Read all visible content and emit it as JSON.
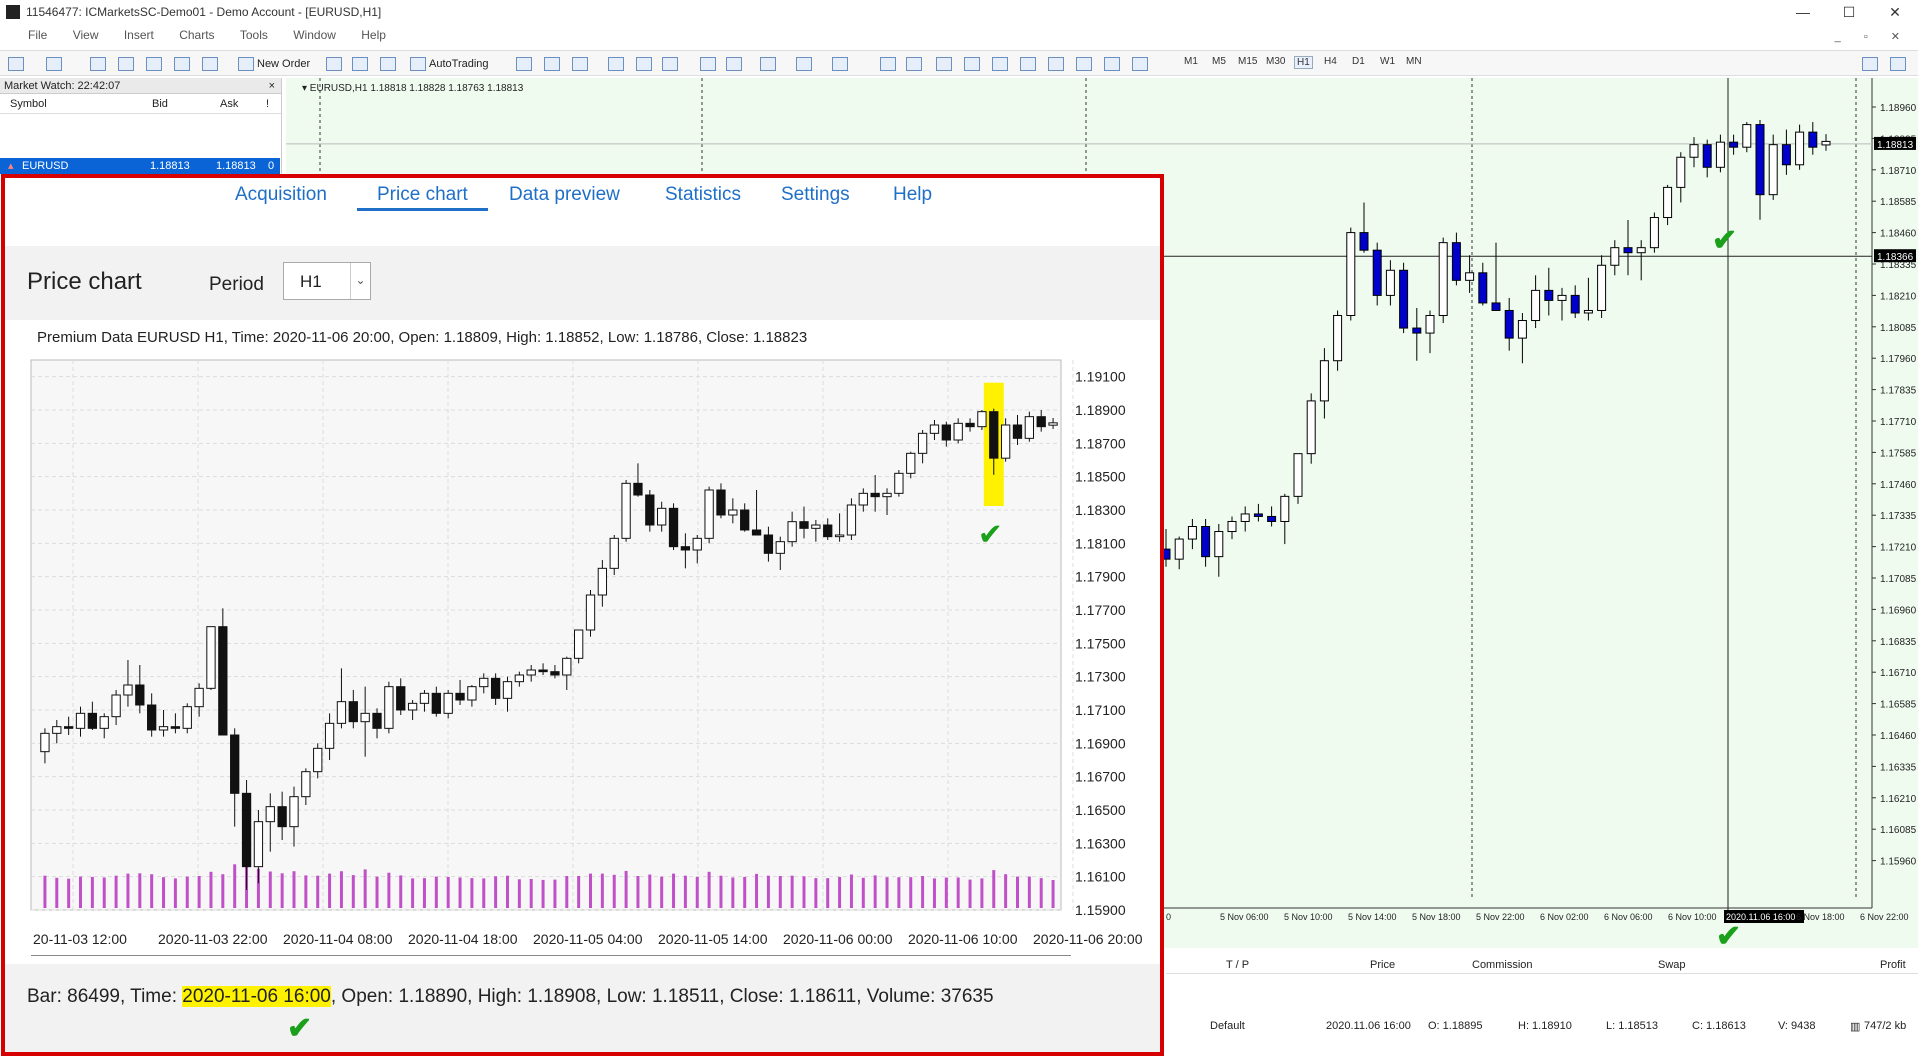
{
  "window": {
    "title": "11546477: ICMarketsSC-Demo01 - Demo Account - [EURUSD,H1]",
    "minimize": "—",
    "maximize": "☐",
    "close": "✕"
  },
  "menu": [
    "File",
    "View",
    "Insert",
    "Charts",
    "Tools",
    "Window",
    "Help"
  ],
  "mdi_controls": "_ ▫ ✕",
  "toolbar": {
    "new_order": "New Order",
    "auto_trading": "AutoTrading",
    "timeframes": [
      "M1",
      "M5",
      "M15",
      "M30",
      "H1",
      "H4",
      "D1",
      "W1",
      "MN"
    ],
    "active_timeframe": "H1"
  },
  "market_watch": {
    "title": "Market Watch: 22:42:07",
    "close": "×",
    "columns": {
      "symbol": "Symbol",
      "bid": "Bid",
      "ask": "Ask",
      "flag": "!"
    },
    "row": {
      "symbol": "EURUSD",
      "bid": "1.18813",
      "ask": "1.18813",
      "flag": "0"
    }
  },
  "mt_chart": {
    "header": "EURUSD,H1  1.18818 1.18828 1.18763 1.18813",
    "price_labels": [
      "1.18960",
      "1.18835",
      "1.18710",
      "1.18585",
      "1.18460",
      "1.18335",
      "1.18210",
      "1.18085",
      "1.17960",
      "1.17835",
      "1.17710",
      "1.17585",
      "1.17460",
      "1.17335",
      "1.17210",
      "1.17085",
      "1.16960",
      "1.16835",
      "1.16710",
      "1.16585",
      "1.16460",
      "1.16335",
      "1.16210",
      "1.16085",
      "1.15960"
    ],
    "current_price_tag": "1.18813",
    "crosshair_price_tag": "1.18366",
    "time_labels": [
      "0",
      "5 Nov 06:00",
      "5 Nov 10:00",
      "5 Nov 14:00",
      "5 Nov 18:00",
      "5 Nov 22:00",
      "6 Nov 02:00",
      "6 Nov 06:00",
      "6 Nov 10:00",
      "2020.11.06 16:00",
      "6 Nov 18:00",
      "6 Nov 22:00"
    ],
    "colors": {
      "background": "#f0fbf0",
      "bull": "#ffffff",
      "bear": "#0000cc",
      "grid": "#3a3a3a"
    }
  },
  "terminal": {
    "columns": [
      "T / P",
      "Price",
      "Commission",
      "Swap",
      "Profit"
    ]
  },
  "status_bar": {
    "profile": "Default",
    "time": "2020.11.06 16:00",
    "open": "O: 1.18895",
    "high": "H: 1.18910",
    "low": "L: 1.18513",
    "close": "C: 1.18613",
    "volume": "V: 9438",
    "traffic": "747/2 kb"
  },
  "panel": {
    "tabs": [
      {
        "label": "Acquisition",
        "active": false
      },
      {
        "label": "Price chart",
        "active": true
      },
      {
        "label": "Data preview",
        "active": false
      },
      {
        "label": "Statistics",
        "active": false
      },
      {
        "label": "Settings",
        "active": false
      },
      {
        "label": "Help",
        "active": false
      }
    ],
    "title": "Price chart",
    "period_label": "Period",
    "period_value": "H1",
    "bar_info": {
      "prefix": "Bar: 86499, Time: ",
      "time": "2020-11-06 16:00",
      "suffix": ", Open: 1.18890, High: 1.18908, Low: 1.18511, Close: 1.18611, Volume: 37635"
    },
    "check_mark": "✔",
    "colors": {
      "border": "#d60000",
      "highlight": "#fff200",
      "link": "#1f6fc7",
      "volume": "#c050c8",
      "check": "#1aa01a"
    }
  },
  "chart_data": {
    "type": "candlestick",
    "title": "Premium Data EURUSD H1, Time: 2020-11-06 20:00, Open: 1.18809, High: 1.18852, Low: 1.18786, Close: 1.18823",
    "ylim": [
      1.159,
      1.192
    ],
    "yticks": [
      "1.19100",
      "1.18900",
      "1.18700",
      "1.18500",
      "1.18300",
      "1.18100",
      "1.17900",
      "1.17700",
      "1.17500",
      "1.17300",
      "1.17100",
      "1.16900",
      "1.16700",
      "1.16500",
      "1.16300",
      "1.16100",
      "1.15900"
    ],
    "xticks": [
      "20-11-03 12:00",
      "2020-11-03 22:00",
      "2020-11-04 08:00",
      "2020-11-04 18:00",
      "2020-11-05 04:00",
      "2020-11-05 14:00",
      "2020-11-06 00:00",
      "2020-11-06 10:00",
      "2020-11-06 20:00"
    ],
    "highlighted_bar_index": 80,
    "ohlc": [
      [
        1.1685,
        1.1699,
        1.1678,
        1.1696
      ],
      [
        1.1696,
        1.1704,
        1.169,
        1.17
      ],
      [
        1.17,
        1.1706,
        1.1695,
        1.1699
      ],
      [
        1.1699,
        1.1712,
        1.1694,
        1.1708
      ],
      [
        1.1708,
        1.1715,
        1.1698,
        1.1699
      ],
      [
        1.1699,
        1.1708,
        1.1693,
        1.1706
      ],
      [
        1.1706,
        1.1722,
        1.1701,
        1.1719
      ],
      [
        1.1719,
        1.174,
        1.1712,
        1.1725
      ],
      [
        1.1725,
        1.1737,
        1.1708,
        1.1713
      ],
      [
        1.1713,
        1.172,
        1.1694,
        1.1698
      ],
      [
        1.1698,
        1.171,
        1.1694,
        1.17
      ],
      [
        1.17,
        1.1708,
        1.1696,
        1.1699
      ],
      [
        1.1699,
        1.1714,
        1.1696,
        1.1712
      ],
      [
        1.1712,
        1.1726,
        1.1706,
        1.1723
      ],
      [
        1.1723,
        1.1756,
        1.1722,
        1.176
      ],
      [
        1.176,
        1.1771,
        1.1745,
        1.1695
      ],
      [
        1.1695,
        1.1699,
        1.164,
        1.166
      ],
      [
        1.166,
        1.1668,
        1.1602,
        1.1616
      ],
      [
        1.1616,
        1.165,
        1.1606,
        1.1643
      ],
      [
        1.1643,
        1.166,
        1.1625,
        1.1652
      ],
      [
        1.1652,
        1.1661,
        1.1632,
        1.164
      ],
      [
        1.164,
        1.1664,
        1.1628,
        1.1658
      ],
      [
        1.1658,
        1.1675,
        1.1653,
        1.1673
      ],
      [
        1.1673,
        1.169,
        1.1669,
        1.1687
      ],
      [
        1.1687,
        1.1708,
        1.168,
        1.1702
      ],
      [
        1.1702,
        1.1735,
        1.1699,
        1.1715
      ],
      [
        1.1715,
        1.1722,
        1.1699,
        1.1703
      ],
      [
        1.1703,
        1.1724,
        1.1682,
        1.1708
      ],
      [
        1.1708,
        1.1711,
        1.1693,
        1.1699
      ],
      [
        1.1699,
        1.1727,
        1.1696,
        1.1724
      ],
      [
        1.1724,
        1.1729,
        1.1707,
        1.171
      ],
      [
        1.171,
        1.1716,
        1.1704,
        1.1714
      ],
      [
        1.1714,
        1.1722,
        1.1709,
        1.172
      ],
      [
        1.172,
        1.1724,
        1.1706,
        1.1708
      ],
      [
        1.1708,
        1.1722,
        1.1705,
        1.172
      ],
      [
        1.172,
        1.1728,
        1.1713,
        1.1716
      ],
      [
        1.1716,
        1.1725,
        1.1712,
        1.1724
      ],
      [
        1.1724,
        1.1732,
        1.172,
        1.1729
      ],
      [
        1.1729,
        1.1732,
        1.1713,
        1.1717
      ],
      [
        1.1717,
        1.173,
        1.1709,
        1.1727
      ],
      [
        1.1727,
        1.1733,
        1.1724,
        1.1731
      ],
      [
        1.1731,
        1.1737,
        1.1727,
        1.1734
      ],
      [
        1.1734,
        1.1738,
        1.1731,
        1.1733
      ],
      [
        1.1733,
        1.1737,
        1.1729,
        1.1731
      ],
      [
        1.1731,
        1.1742,
        1.1722,
        1.1741
      ],
      [
        1.1741,
        1.1758,
        1.1738,
        1.1758
      ],
      [
        1.1758,
        1.1782,
        1.1754,
        1.1779
      ],
      [
        1.1779,
        1.18,
        1.1772,
        1.1795
      ],
      [
        1.1795,
        1.1815,
        1.1791,
        1.1813
      ],
      [
        1.1813,
        1.1848,
        1.1811,
        1.1846
      ],
      [
        1.1846,
        1.1858,
        1.1838,
        1.1839
      ],
      [
        1.1839,
        1.1842,
        1.1817,
        1.1821
      ],
      [
        1.1821,
        1.1835,
        1.1817,
        1.1831
      ],
      [
        1.1831,
        1.1834,
        1.1806,
        1.1808
      ],
      [
        1.1808,
        1.1816,
        1.1795,
        1.1806
      ],
      [
        1.1806,
        1.1815,
        1.1798,
        1.1813
      ],
      [
        1.1813,
        1.1844,
        1.181,
        1.1842
      ],
      [
        1.1842,
        1.1846,
        1.1825,
        1.1827
      ],
      [
        1.1827,
        1.1837,
        1.1822,
        1.183
      ],
      [
        1.183,
        1.1834,
        1.1817,
        1.1818
      ],
      [
        1.1818,
        1.1842,
        1.1815,
        1.1815
      ],
      [
        1.1815,
        1.182,
        1.1799,
        1.1804
      ],
      [
        1.1804,
        1.1814,
        1.1794,
        1.1811
      ],
      [
        1.1811,
        1.1829,
        1.1808,
        1.1823
      ],
      [
        1.1823,
        1.1832,
        1.1813,
        1.1819
      ],
      [
        1.1819,
        1.1824,
        1.1811,
        1.1821
      ],
      [
        1.1821,
        1.1825,
        1.1812,
        1.1814
      ],
      [
        1.1814,
        1.1828,
        1.1811,
        1.1815
      ],
      [
        1.1815,
        1.1837,
        1.1812,
        1.1833
      ],
      [
        1.1833,
        1.1843,
        1.1829,
        1.184
      ],
      [
        1.184,
        1.1851,
        1.1829,
        1.1838
      ],
      [
        1.1838,
        1.1843,
        1.1827,
        1.184
      ],
      [
        1.184,
        1.1854,
        1.1838,
        1.1852
      ],
      [
        1.1852,
        1.1865,
        1.1849,
        1.1864
      ],
      [
        1.1864,
        1.1878,
        1.1858,
        1.1876
      ],
      [
        1.1876,
        1.1884,
        1.1872,
        1.1881
      ],
      [
        1.1881,
        1.1883,
        1.1868,
        1.1872
      ],
      [
        1.1872,
        1.1885,
        1.187,
        1.1882
      ],
      [
        1.1882,
        1.1885,
        1.1877,
        1.188
      ],
      [
        1.188,
        1.189,
        1.1878,
        1.1889
      ],
      [
        1.1889,
        1.18908,
        1.18511,
        1.18611
      ],
      [
        1.18611,
        1.1885,
        1.1859,
        1.1881
      ],
      [
        1.1881,
        1.1887,
        1.1869,
        1.1873
      ],
      [
        1.1873,
        1.1889,
        1.1871,
        1.1886
      ],
      [
        1.1886,
        1.189,
        1.1877,
        1.188
      ],
      [
        1.18809,
        1.18852,
        1.18786,
        1.18823
      ]
    ]
  }
}
